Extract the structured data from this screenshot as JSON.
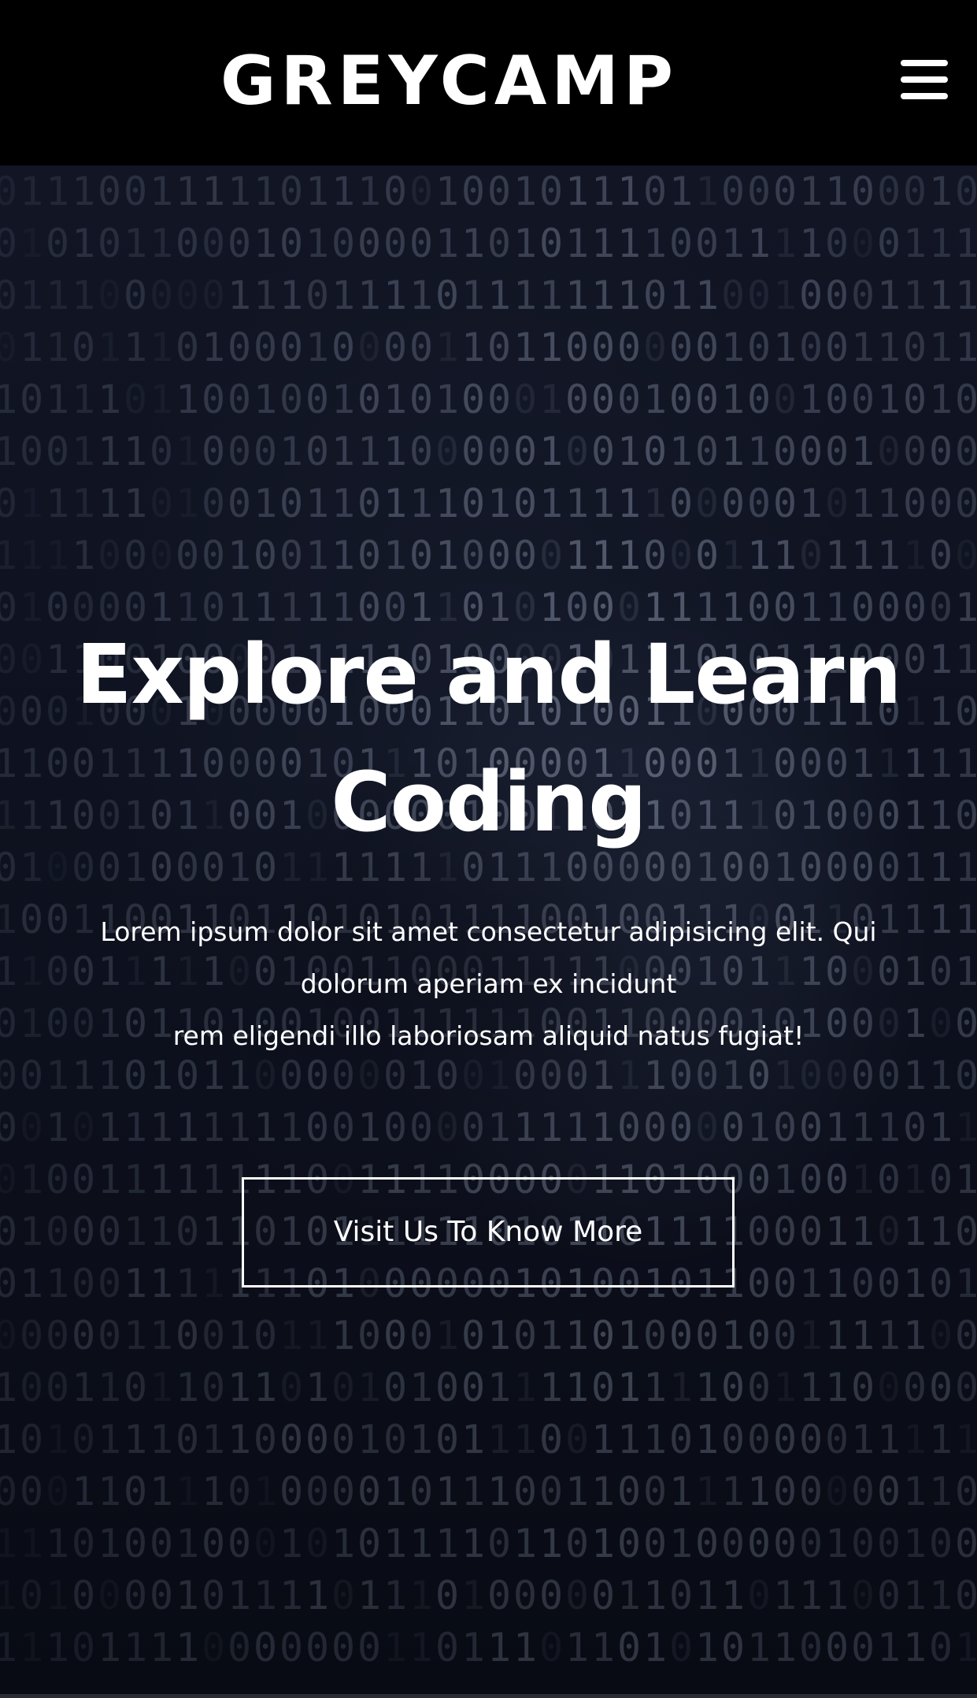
{
  "header": {
    "brand": "GREYCAMP",
    "menu_icon": "hamburger-menu-icon"
  },
  "hero": {
    "headline": "Explore and Learn Coding",
    "subtext_lines": [
      "Lorem ipsum dolor sit amet consectetur adipisicing elit. Qui",
      "dolorum aperiam ex incidunt",
      "rem eligendi illo laboriosam aliquid natus fugiat!"
    ],
    "cta_label": "Visit Us To Know More",
    "background": "binary-code-image"
  },
  "colors": {
    "header_bg": "#000000",
    "hero_bg": "#0e1220",
    "text": "#ffffff",
    "binary_digits": "#8a93a8"
  }
}
